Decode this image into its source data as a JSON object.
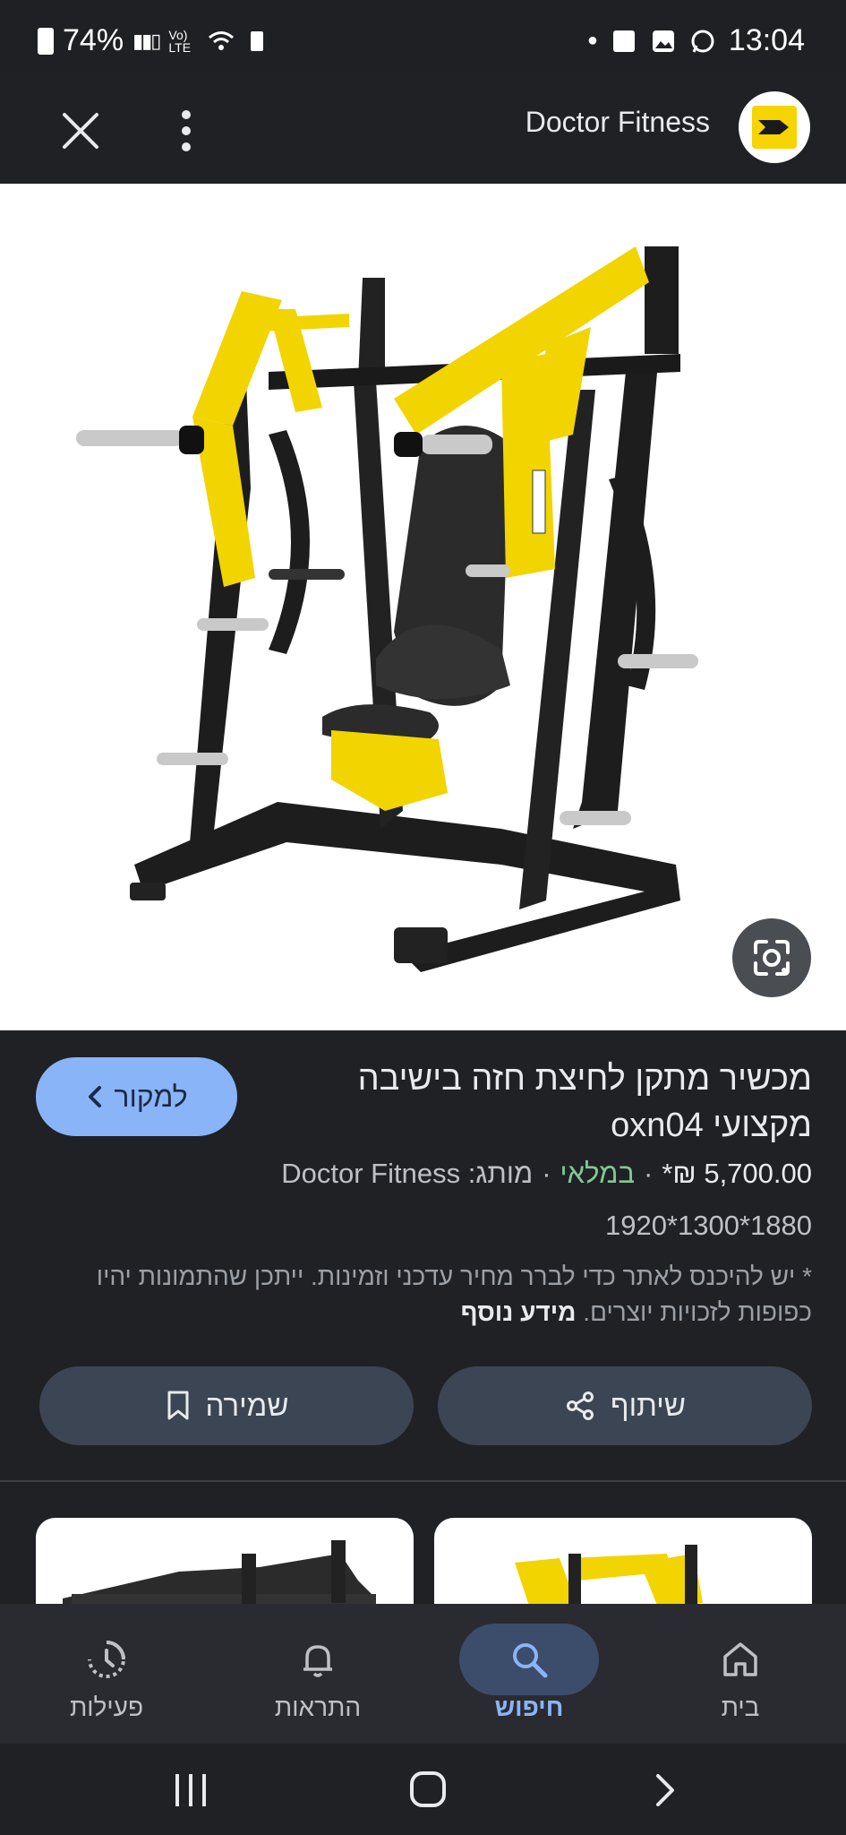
{
  "status_bar": {
    "battery": "74%",
    "time": "13:04",
    "network": "Vo) LTE"
  },
  "header": {
    "site_name": "Doctor Fitness"
  },
  "product": {
    "title": "מכשיר מתקן לחיצת חזה בישיבה מקצועי oxn04",
    "price": "5,700.00 ₪*",
    "availability": "במלאי",
    "brand": "מותג: Doctor Fitness",
    "dimensions": "1920*1300*1880",
    "note_text": "* יש להיכנס לאתר כדי לברר מחיר עדכני וזמינות. ייתכן שהתמונות יהיו כפופות לזכויות יוצרים.",
    "note_more": "מידע נוסף"
  },
  "buttons": {
    "visit": "למקור",
    "share": "שיתוף",
    "save": "שמירה"
  },
  "bottom_nav": [
    {
      "label": "בית",
      "icon": "home-icon"
    },
    {
      "label": "חיפוש",
      "icon": "search-icon"
    },
    {
      "label": "התראות",
      "icon": "bell-icon"
    },
    {
      "label": "פעילות",
      "icon": "activity-icon"
    }
  ],
  "colors": {
    "accent": "#8ab4f8",
    "in_stock": "#81c995",
    "background": "#202124",
    "brand_yellow": "#f5d400"
  }
}
